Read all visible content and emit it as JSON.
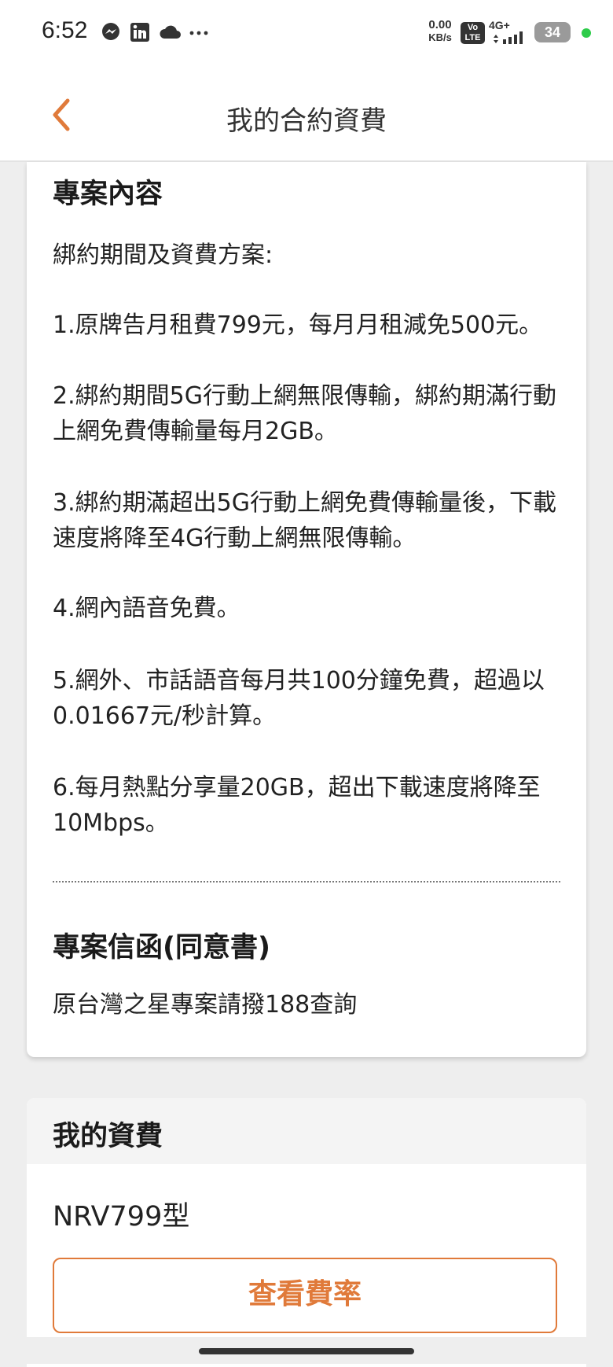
{
  "status_bar": {
    "time": "6:52",
    "net_speed_value": "0.00",
    "net_speed_unit": "KB/s",
    "volte_line1": "Vo",
    "volte_line2": "LTE",
    "network": "4G+",
    "battery": "34",
    "notification_icons": [
      "messenger-icon",
      "linkedin-icon",
      "cloud-icon",
      "more-dots-icon"
    ],
    "dot_color": "#2ecc4a"
  },
  "header": {
    "title": "我的合約資費",
    "back_icon": "chevron-left-icon",
    "accent": "#e07a3a"
  },
  "plan_content": {
    "title": "專案內容",
    "intro": "綁約期間及資費方案:",
    "items": [
      "1.原牌告月租費799元，每月月租減免500元。",
      "2.綁約期間5G行動上網無限傳輸，綁約期滿行動上網免費傳輸量每月2GB。",
      "3.綁約期滿超出5G行動上網免費傳輸量後，下載速度將降至4G行動上網無限傳輸。",
      "4.網內語音免費。",
      "5.網外、市話語音每月共100分鐘免費，超過以0.01667元/秒計算。",
      "6.每月熱點分享量20GB，超出下載速度將降至10Mbps。"
    ]
  },
  "letter": {
    "title": "專案信函(同意書)",
    "text": "原台灣之星專案請撥188查詢"
  },
  "my_plan": {
    "title": "我的資費",
    "plan_name": "NRV799型",
    "button_label": "查看費率"
  }
}
